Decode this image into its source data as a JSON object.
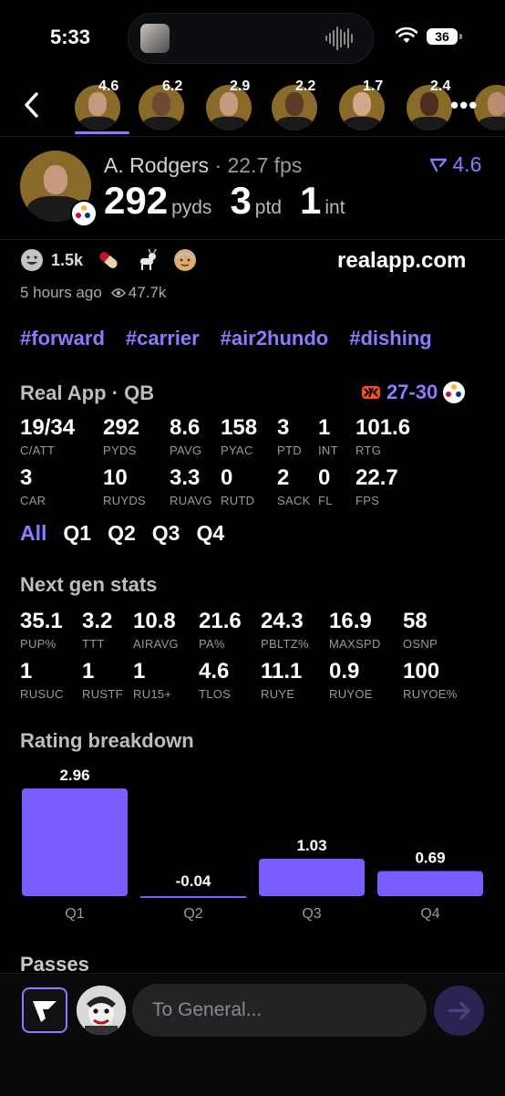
{
  "status": {
    "time": "5:33",
    "battery": "36"
  },
  "players": [
    {
      "rating": "4.6",
      "skin": "#c79a7d"
    },
    {
      "rating": "6.2",
      "skin": "#6b4a34"
    },
    {
      "rating": "2.9",
      "skin": "#c79a7d"
    },
    {
      "rating": "2.2",
      "skin": "#5c3c29"
    },
    {
      "rating": "1.7",
      "skin": "#d1a98a"
    },
    {
      "rating": "2.4",
      "skin": "#4a2f1f"
    },
    {
      "rating": "",
      "skin": "#b98d6f"
    }
  ],
  "profile": {
    "name": "A. Rodgers",
    "fps": "22.7 fps",
    "rating": "4.6",
    "headline": [
      {
        "value": "292",
        "unit": "pyds"
      },
      {
        "value": "3",
        "unit": "ptd"
      },
      {
        "value": "1",
        "unit": "int"
      }
    ]
  },
  "reactions": {
    "count": "1.5k",
    "icons": [
      "grin-emoji-icon",
      "pill-emoji-icon",
      "goat-emoji-icon",
      "old-man-emoji-icon"
    ]
  },
  "meta": {
    "site": "realapp.com",
    "ago": "5 hours ago",
    "views": "47.7k"
  },
  "tags": [
    "#forward",
    "#carrier",
    "#air2hundo",
    "#dishing"
  ],
  "game": {
    "title": "Real App · QB",
    "score": "27-30"
  },
  "stats_rows": [
    [
      {
        "v": "19/34",
        "l": "C/ATT"
      },
      {
        "v": "292",
        "l": "PYDS"
      },
      {
        "v": "8.6",
        "l": "PAVG"
      },
      {
        "v": "158",
        "l": "PYAC"
      },
      {
        "v": "3",
        "l": "PTD"
      },
      {
        "v": "1",
        "l": "INT"
      },
      {
        "v": "101.6",
        "l": "RTG"
      }
    ],
    [
      {
        "v": "3",
        "l": "CAR"
      },
      {
        "v": "10",
        "l": "RUYDS"
      },
      {
        "v": "3.3",
        "l": "RUAVG"
      },
      {
        "v": "0",
        "l": "RUTD"
      },
      {
        "v": "2",
        "l": "SACK"
      },
      {
        "v": "0",
        "l": "FL"
      },
      {
        "v": "22.7",
        "l": "FPS"
      }
    ]
  ],
  "quarter_tabs": [
    "All",
    "Q1",
    "Q2",
    "Q3",
    "Q4"
  ],
  "next_gen": {
    "title": "Next gen stats",
    "rows": [
      [
        {
          "v": "35.1",
          "l": "PUP%"
        },
        {
          "v": "3.2",
          "l": "TTT"
        },
        {
          "v": "10.8",
          "l": "AIRAVG"
        },
        {
          "v": "21.6",
          "l": "PA%"
        },
        {
          "v": "24.3",
          "l": "PBLTZ%"
        },
        {
          "v": "16.9",
          "l": "MAXSPD"
        },
        {
          "v": "58",
          "l": "OSNP"
        }
      ],
      [
        {
          "v": "1",
          "l": "RUSUC"
        },
        {
          "v": "1",
          "l": "RUSTF"
        },
        {
          "v": "1",
          "l": "RU15+"
        },
        {
          "v": "4.6",
          "l": "TLOS"
        },
        {
          "v": "11.1",
          "l": "RUYE"
        },
        {
          "v": "0.9",
          "l": "RUYOE"
        },
        {
          "v": "100",
          "l": "RUYOE%"
        }
      ]
    ]
  },
  "chart_data": {
    "type": "bar",
    "title": "Rating breakdown",
    "categories": [
      "Q1",
      "Q2",
      "Q3",
      "Q4"
    ],
    "values": [
      2.96,
      -0.04,
      1.03,
      0.69
    ],
    "data_labels": [
      "2.96",
      "-0.04",
      "1.03",
      "0.69"
    ],
    "color": "#7b5cff",
    "ylim": [
      -0.04,
      2.96
    ],
    "grid": false
  },
  "passes": {
    "title": "Passes"
  },
  "composer": {
    "placeholder": "To General..."
  },
  "colors": {
    "accent": "#8b7bff",
    "bar": "#7b5cff",
    "team_gold": "#f5b820"
  }
}
